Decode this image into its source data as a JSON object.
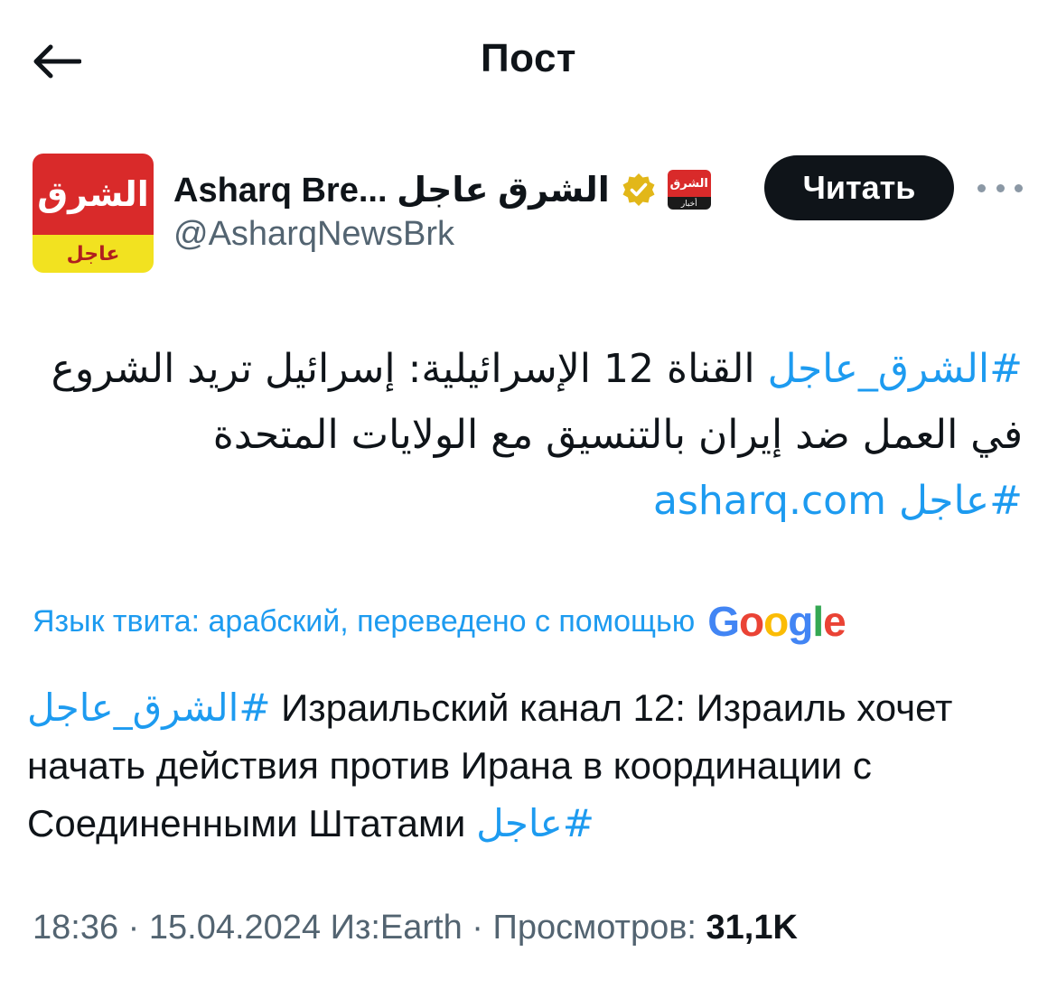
{
  "topbar": {
    "title": "Пост"
  },
  "account": {
    "avatar_top_text": "الشرق",
    "avatar_bottom_text": "عاجل",
    "display_name": "Asharq Bre... الشرق عاجل",
    "handle": "@AsharqNewsBrk",
    "affiliate_top_text": "الشرق",
    "affiliate_bottom_text": "أخبار"
  },
  "follow_label": "Читать",
  "tweet": {
    "hashtag_main": "#الشرق_عاجل",
    "body_text": " القناة 12 الإسرائيلية: إسرائيل تريد الشروع في العمل ضد إيران بالتنسيق مع الولايات المتحدة",
    "hashtag_break": "#عاجل",
    "link": "asharq.com"
  },
  "translation": {
    "notice": "Язык твита: арабский, переведено с помощью",
    "provider": "Google",
    "hashtag_main": "#الشرق_عاجل",
    "text": " Израильский канал 12: Израиль хочет начать действия против Ирана в координации с Соединенными Штатами ",
    "hashtag_break": "#عاجل"
  },
  "meta": {
    "time": "18:36",
    "date": "15.04.2024",
    "source": "Из:Earth",
    "views_label": "Просмотров:",
    "views_count": "31,1K",
    "separator": " · "
  },
  "colors": {
    "accent": "#1d9bf0",
    "text": "#0f1419",
    "secondary": "#536471",
    "verified": "#e2b719"
  }
}
